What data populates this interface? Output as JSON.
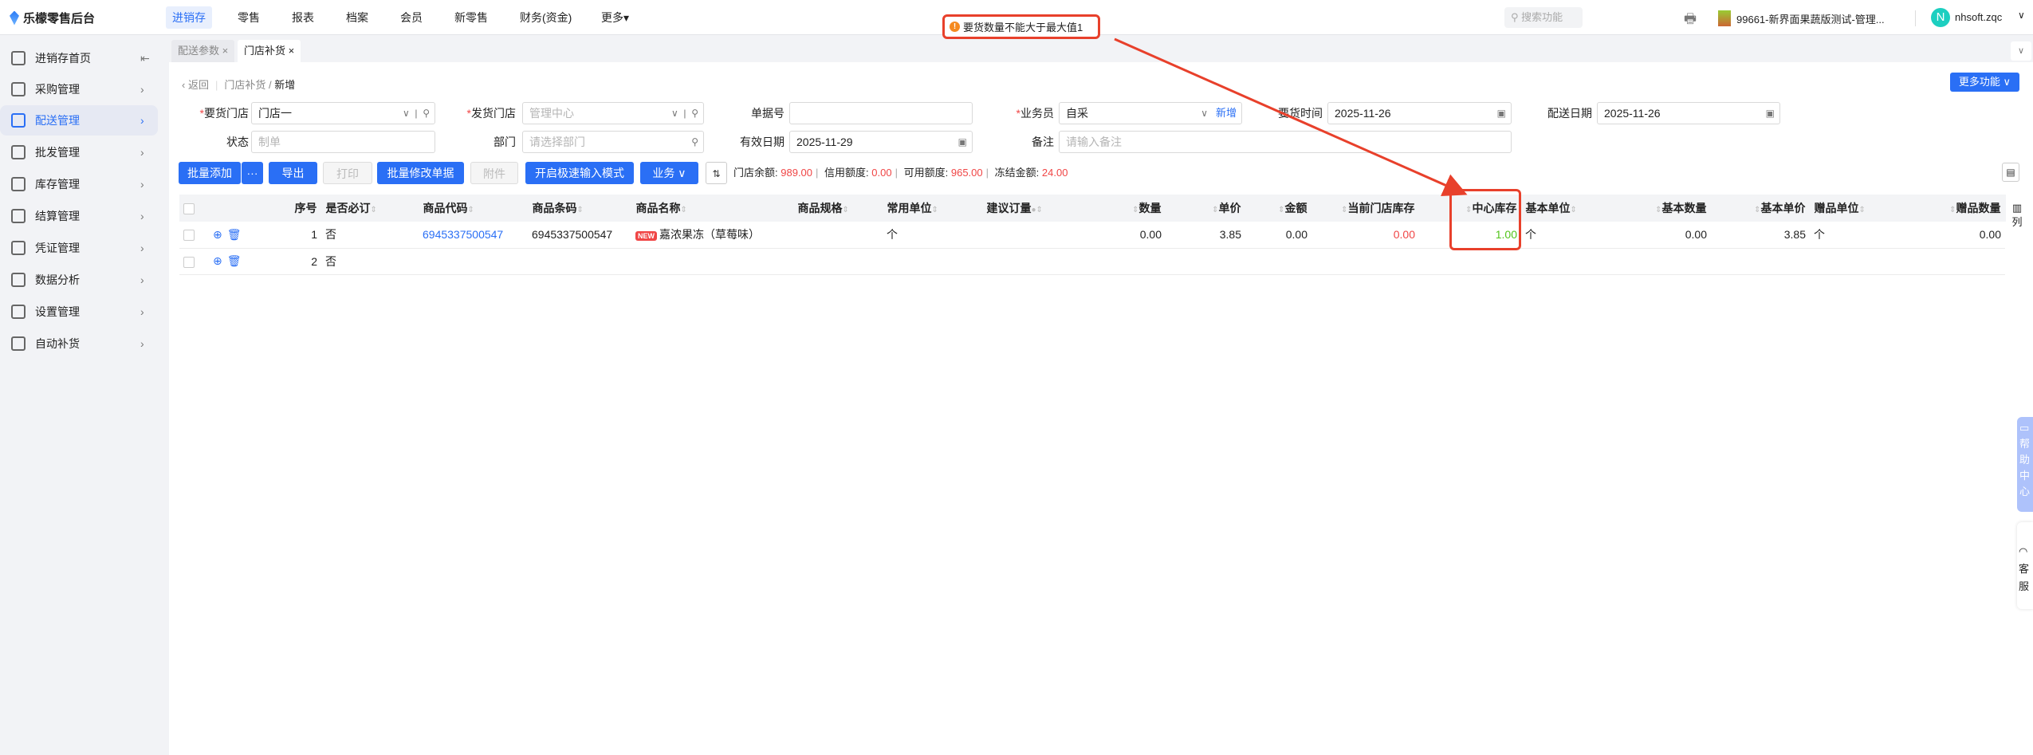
{
  "app": {
    "title": "乐檬零售后台"
  },
  "nav": {
    "items": [
      "进销存",
      "零售",
      "报表",
      "档案",
      "会员",
      "新零售",
      "财务(资金)",
      "更多▾"
    ],
    "search_placeholder": "搜索功能",
    "store": "99661-新界面果蔬版测试-管理...",
    "user": "nhsoft.zqc",
    "avatar": "N"
  },
  "toast": {
    "message": "要货数量不能大于最大值1"
  },
  "sidebar": {
    "items": [
      {
        "label": "进销存首页",
        "icon": "home-icon"
      },
      {
        "label": "采购管理",
        "icon": "cart-icon"
      },
      {
        "label": "配送管理",
        "icon": "map-icon"
      },
      {
        "label": "批发管理",
        "icon": "server-icon"
      },
      {
        "label": "库存管理",
        "icon": "inbox-icon"
      },
      {
        "label": "结算管理",
        "icon": "dollar-icon"
      },
      {
        "label": "凭证管理",
        "icon": "document-icon"
      },
      {
        "label": "数据分析",
        "icon": "chart-icon"
      },
      {
        "label": "设置管理",
        "icon": "settings-icon"
      },
      {
        "label": "自动补货",
        "icon": "robot-icon"
      }
    ],
    "active": "配送管理"
  },
  "tabs": [
    {
      "label": "配送参数 ×"
    },
    {
      "label": "门店补货 ×"
    }
  ],
  "breadcrumb": {
    "back": "返回",
    "parent": "门店补货",
    "current": "新增"
  },
  "more_button": "更多功能",
  "form": {
    "req_store": {
      "label": "要货门店",
      "value": "门店一"
    },
    "ship_store": {
      "label": "发货门店",
      "value": "管理中心"
    },
    "doc_no": {
      "label": "单据号",
      "value": ""
    },
    "salesman": {
      "label": "业务员",
      "value": "自采",
      "link": "新增"
    },
    "req_time": {
      "label": "要货时间",
      "value": "2025-11-26"
    },
    "ship_date": {
      "label": "配送日期",
      "value": "2025-11-26"
    },
    "status": {
      "label": "状态",
      "placeholder": "制单"
    },
    "dept": {
      "label": "部门",
      "placeholder": "请选择部门"
    },
    "valid_date": {
      "label": "有效日期",
      "value": "2025-11-29"
    },
    "remark": {
      "label": "备注",
      "placeholder": "请输入备注"
    }
  },
  "toolbar": {
    "batch_add": "批量添加",
    "more": "···",
    "export": "导出",
    "print": "打印",
    "batch_edit": "批量修改单据",
    "attach": "附件",
    "fast_mode": "开启极速输入模式",
    "business": "业务 ∨"
  },
  "summary": {
    "balance_label": "门店余额:",
    "balance": "989.00",
    "credit_label": "信用额度:",
    "credit": "0.00",
    "avail_label": "可用额度:",
    "avail": "965.00",
    "frozen_label": "冻结金额:",
    "frozen": "24.00"
  },
  "table": {
    "columns": [
      "",
      "",
      "序号",
      "是否必订",
      "商品代码",
      "商品条码",
      "商品名称",
      "商品规格",
      "常用单位",
      "建议订量",
      "数量",
      "单价",
      "金额",
      "当前门店库存",
      "中心库存",
      "基本单位",
      "基本数量",
      "基本单价",
      "赠品单位",
      "赠品数量"
    ],
    "rows": [
      {
        "seq": "1",
        "must": "否",
        "code": "6945337500547",
        "barcode": "6945337500547",
        "badge": "NEW",
        "name": "嘉浓果冻（草莓味）",
        "spec": "",
        "unit": "个",
        "suggest": "",
        "qty": "0.00",
        "price": "3.85",
        "amount": "0.00",
        "cur_stock": "0.00",
        "center_stock": "1.00",
        "base_unit": "个",
        "base_qty": "0.00",
        "base_price": "3.85",
        "gift_unit": "个",
        "gift_qty": "0.00"
      },
      {
        "seq": "2",
        "must": "否",
        "code": "",
        "barcode": "",
        "badge": "",
        "name": "",
        "spec": "",
        "unit": "",
        "suggest": "",
        "qty": "",
        "price": "",
        "amount": "",
        "cur_stock": "",
        "center_stock": "",
        "base_unit": "",
        "base_qty": "",
        "base_price": "",
        "gift_unit": "",
        "gift_qty": ""
      }
    ],
    "column_button": "列"
  },
  "float": {
    "help": "帮助中心",
    "service": "客服"
  },
  "colors": {
    "accent": "#2a6ff5",
    "red": "#f04646",
    "green": "#52c41a",
    "highlight": "#e8402b"
  }
}
